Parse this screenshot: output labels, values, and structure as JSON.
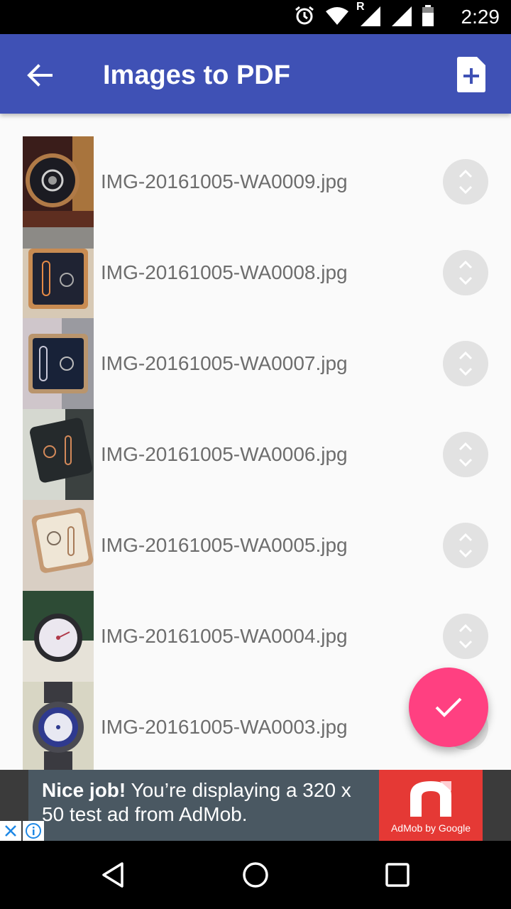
{
  "status_bar": {
    "time": "2:29",
    "icons": [
      "alarm-icon",
      "wifi-icon",
      "signal-roaming-icon",
      "signal-icon",
      "battery-icon"
    ],
    "roaming_label": "R"
  },
  "app_bar": {
    "title": "Images to PDF",
    "back_icon": "arrow-back-icon",
    "add_icon": "add-file-icon",
    "color": "#3f51b5"
  },
  "images": [
    {
      "filename": "IMG-20161005-WA0009.jpg"
    },
    {
      "filename": "IMG-20161005-WA0008.jpg"
    },
    {
      "filename": "IMG-20161005-WA0007.jpg"
    },
    {
      "filename": "IMG-20161005-WA0006.jpg"
    },
    {
      "filename": "IMG-20161005-WA0005.jpg"
    },
    {
      "filename": "IMG-20161005-WA0004.jpg"
    },
    {
      "filename": "IMG-20161005-WA0003.jpg"
    }
  ],
  "fab": {
    "icon": "check-icon",
    "color": "#ff4081"
  },
  "ad": {
    "headline": "Nice job!",
    "body": " You’re displaying a 320 x 50 test ad from AdMob.",
    "brand": "AdMob by Google",
    "close_icon": "close-icon",
    "info_icon": "info-icon"
  },
  "nav_bar": {
    "icons": [
      "back-triangle-icon",
      "home-circle-icon",
      "recents-square-icon"
    ]
  }
}
